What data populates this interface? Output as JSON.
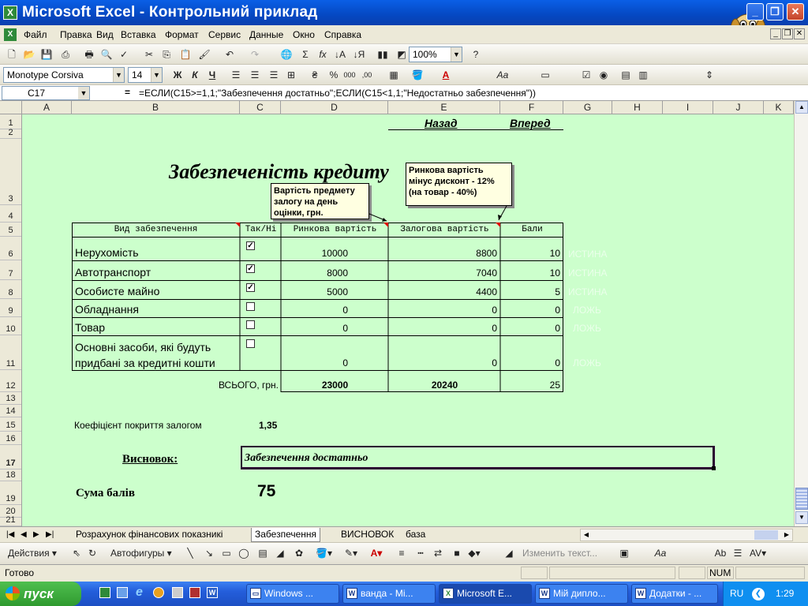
{
  "window": {
    "title": "Microsoft Excel - Контрольний приклад",
    "app_icon": "X"
  },
  "menu": [
    "Файл",
    "Правка",
    "Вид",
    "Вставка",
    "Формат",
    "Сервис",
    "Данные",
    "Окно",
    "Справка"
  ],
  "standard_toolbar": {
    "zoom": "100%"
  },
  "format_toolbar": {
    "font": "Monotype Corsiva",
    "size": "14",
    "bold": "Ж",
    "italic": "К",
    "underline": "Ч"
  },
  "formula_bar": {
    "name_box": "C17",
    "formula": "=ЕСЛИ(C15>=1,1;\"Забезпечення достатньо\";ЕСЛИ(C15<1,1;\"Недостатньо забезпечення\"))"
  },
  "columns": [
    "A",
    "B",
    "C",
    "D",
    "E",
    "F",
    "G",
    "H",
    "I",
    "J",
    "K"
  ],
  "rows": [
    "1",
    "2",
    "3",
    "4",
    "5",
    "6",
    "7",
    "8",
    "9",
    "10",
    "11",
    "12",
    "13",
    "14",
    "15",
    "16",
    "17",
    "18",
    "19",
    "20",
    "21"
  ],
  "sheet": {
    "nav_back": "Назад",
    "nav_forward": "Вперед",
    "heading": "Забезпеченість кредиту",
    "note_market": "Вартість предмету залогу на день оцінки, грн.",
    "note_pledge": "Ринкова вартість мінус дисконт - 12% (на товар - 40%)",
    "table_headers": [
      "Вид забезпечення",
      "Так/Ні",
      "Ринкова вартість",
      "Залогова вартість",
      "Бали"
    ],
    "table_rows": [
      {
        "name": "Нерухомість",
        "checked": true,
        "market": "10000",
        "pledge": "8800",
        "points": "10",
        "flag": "ИСТИНА"
      },
      {
        "name": "Автотранспорт",
        "checked": true,
        "market": "8000",
        "pledge": "7040",
        "points": "10",
        "flag": "ИСТИНА"
      },
      {
        "name": "Особисте майно",
        "checked": true,
        "market": "5000",
        "pledge": "4400",
        "points": "5",
        "flag": "ИСТИНА"
      },
      {
        "name": "Обладнання",
        "checked": false,
        "market": "0",
        "pledge": "0",
        "points": "0",
        "flag": "ЛОЖЬ"
      },
      {
        "name": "Товар",
        "checked": false,
        "market": "0",
        "pledge": "0",
        "points": "0",
        "flag": "ЛОЖЬ"
      },
      {
        "name": "Основні засоби, які будуть придбані за кредитні кошти",
        "checked": false,
        "market": "0",
        "pledge": "0",
        "points": "0",
        "flag": "ЛОЖЬ"
      }
    ],
    "total_label": "ВСЬОГО, грн.",
    "total_market": "23000",
    "total_pledge": "20240",
    "total_points": "25",
    "coverage_label": "Коефіцієнт покриття залогом",
    "coverage_value": "1,35",
    "conclusion_label": "Висновок:",
    "conclusion_value": "Забезпечення достатньо",
    "score_label": "Сума балів",
    "score_value": "75"
  },
  "tabs": [
    "Розрахунок фінансових показникі",
    "Забезпечення",
    "ВИСНОВОК",
    "база"
  ],
  "active_tab": "Забезпечення",
  "draw_toolbar": {
    "actions": "Действия",
    "autoshapes": "Автофигуры",
    "edit_text": "Изменить текст..."
  },
  "status": {
    "ready": "Готово",
    "num": "NUM"
  },
  "taskbar": {
    "start": "пуск",
    "tasks": [
      "Windows ...",
      "ванда - Mi...",
      "Microsoft E...",
      "Мій диплo...",
      "Додатки - ..."
    ],
    "lang": "RU",
    "time": "1:29"
  }
}
